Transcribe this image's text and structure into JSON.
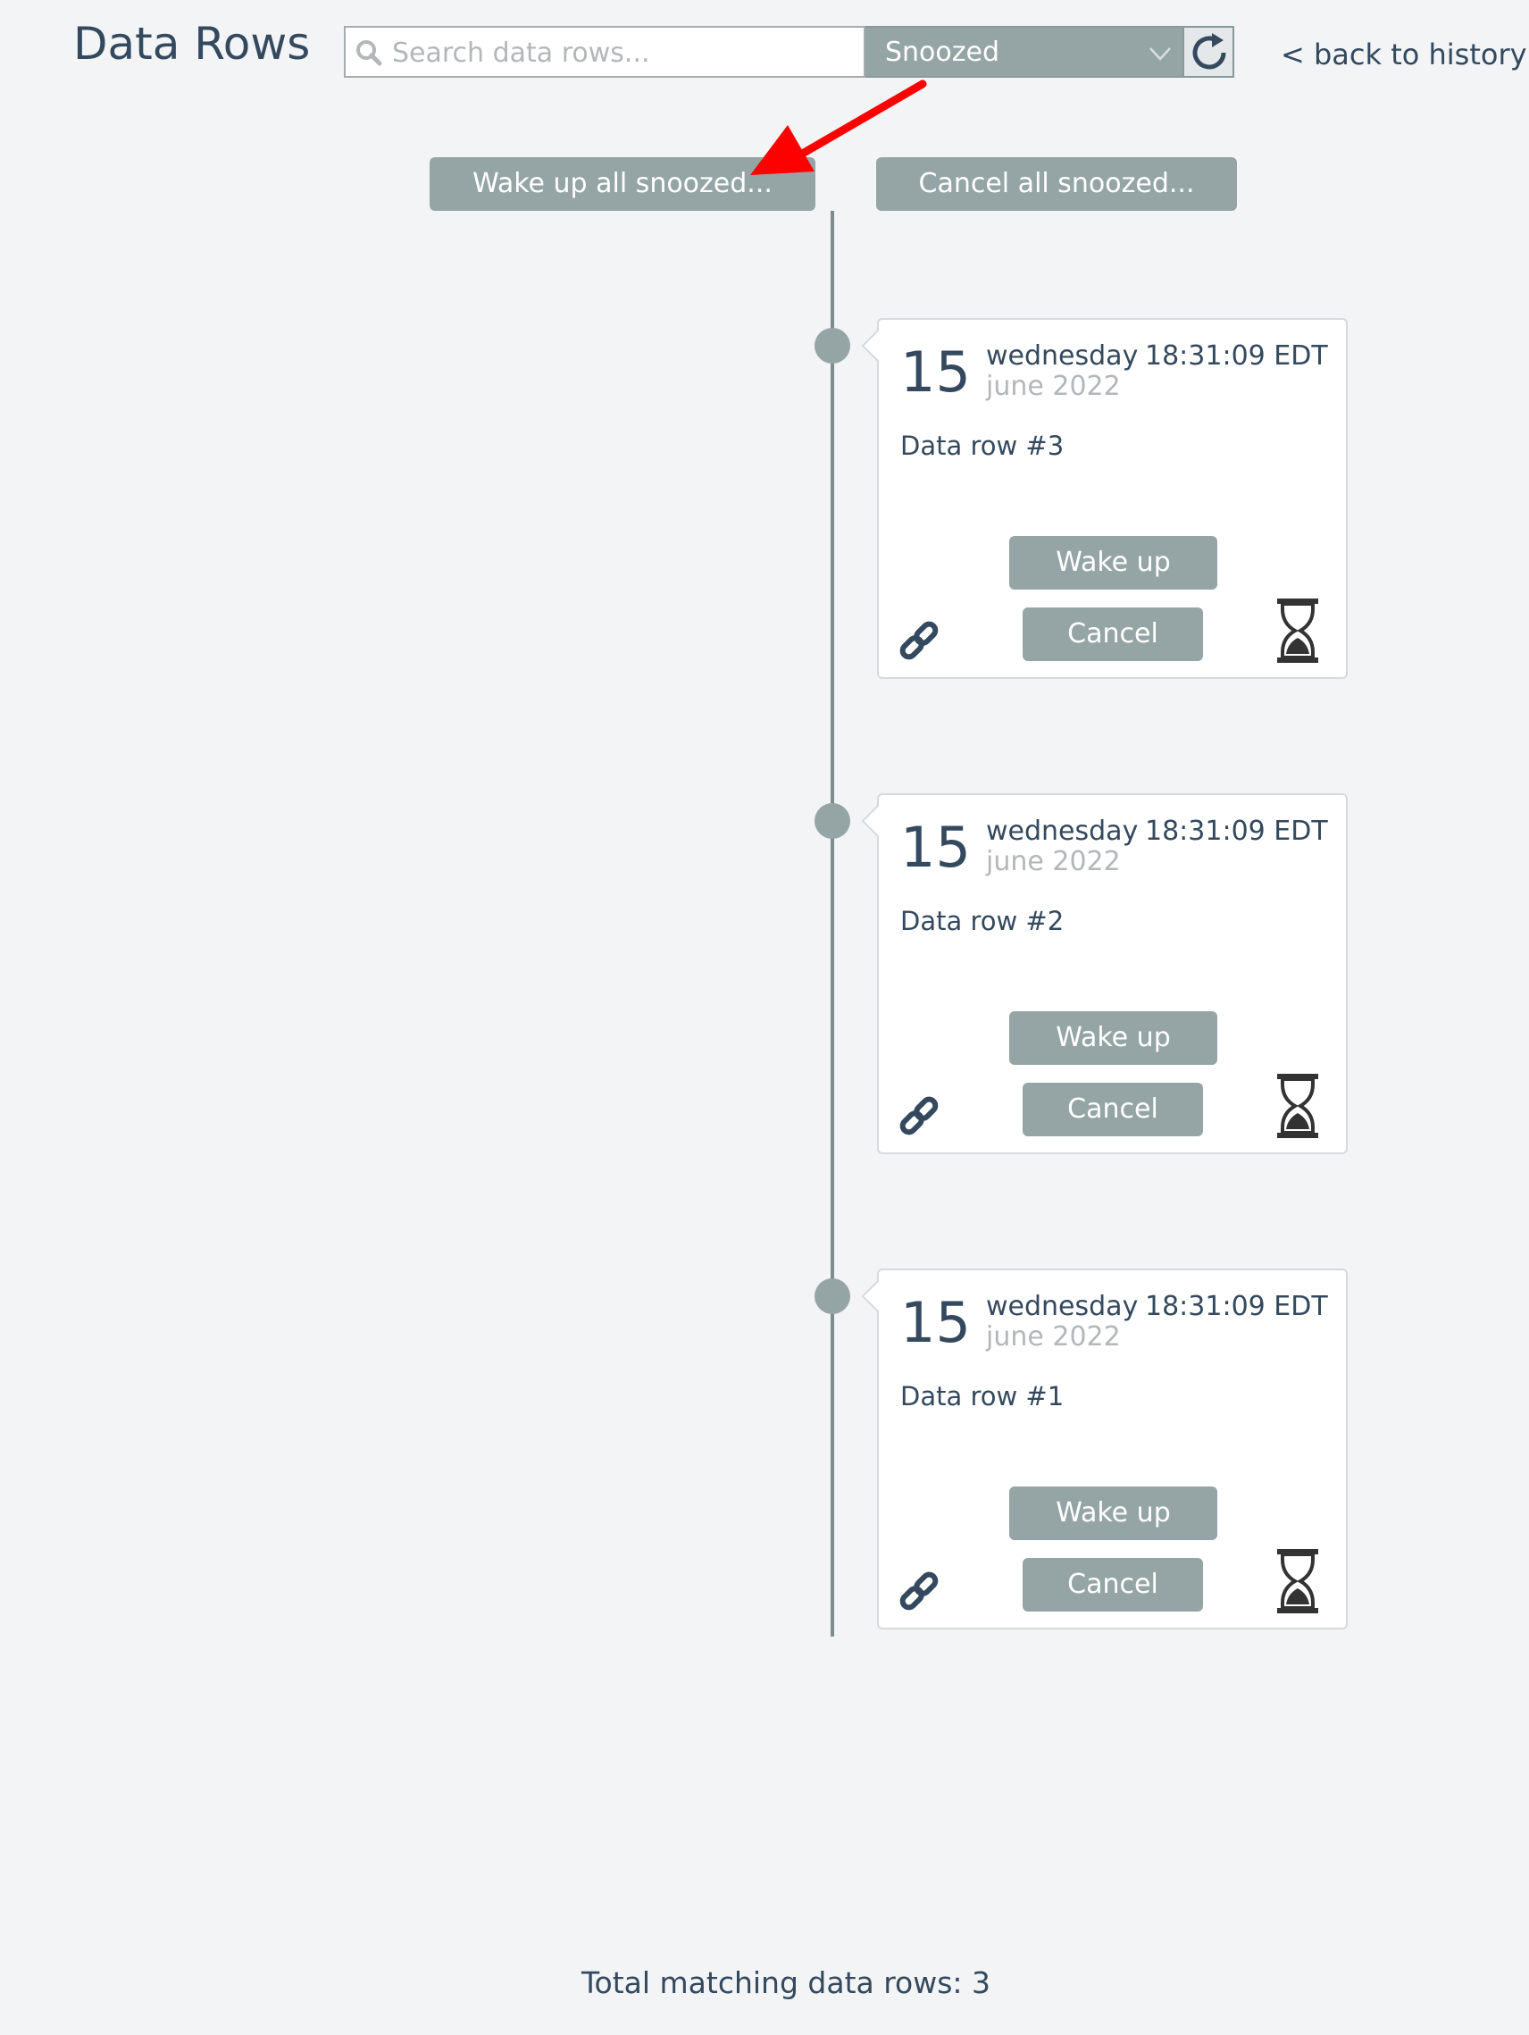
{
  "header": {
    "title": "Data Rows",
    "search": {
      "placeholder": "Search data rows...",
      "value": ""
    },
    "status_filter": {
      "selected": "Snoozed"
    },
    "back_link": "< back to history"
  },
  "bulk_actions": {
    "wake_all": "Wake up all snoozed...",
    "cancel_all": "Cancel all snoozed..."
  },
  "rows": [
    {
      "day": "15",
      "weekday": "wednesday",
      "month": "june 2022",
      "time": "18:31:09 EDT",
      "label": "Data row #3",
      "wake_label": "Wake up",
      "cancel_label": "Cancel"
    },
    {
      "day": "15",
      "weekday": "wednesday",
      "month": "june 2022",
      "time": "18:31:09 EDT",
      "label": "Data row #2",
      "wake_label": "Wake up",
      "cancel_label": "Cancel"
    },
    {
      "day": "15",
      "weekday": "wednesday",
      "month": "june 2022",
      "time": "18:31:09 EDT",
      "label": "Data row #1",
      "wake_label": "Wake up",
      "cancel_label": "Cancel"
    }
  ],
  "footer": {
    "total": "Total matching data rows: 3"
  },
  "colors": {
    "accent": "#95a5a6",
    "text": "#34495e",
    "annotation": "#ff0000"
  },
  "icons": {
    "search": "search-icon",
    "refresh": "refresh-icon",
    "link": "link-icon",
    "snooze": "hourglass-icon"
  }
}
